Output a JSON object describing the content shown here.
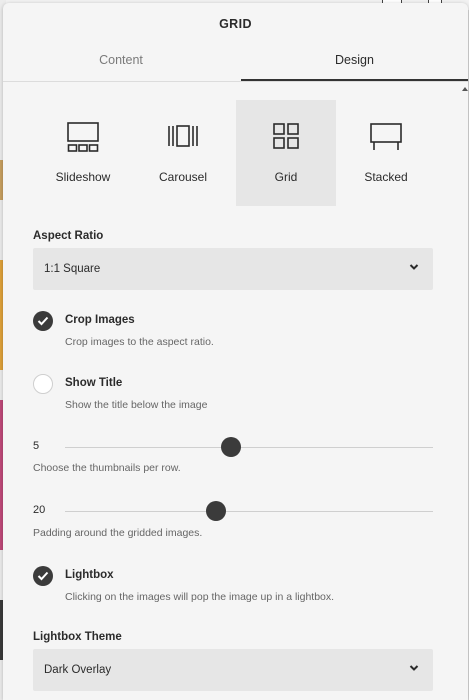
{
  "panel": {
    "title": "GRID"
  },
  "tabs": [
    {
      "label": "Content"
    },
    {
      "label": "Design"
    }
  ],
  "layouts": [
    {
      "label": "Slideshow",
      "icon": "slideshow-icon",
      "selected": false
    },
    {
      "label": "Carousel",
      "icon": "carousel-icon",
      "selected": false
    },
    {
      "label": "Grid",
      "icon": "grid-icon",
      "selected": true
    },
    {
      "label": "Stacked",
      "icon": "stacked-icon",
      "selected": false
    }
  ],
  "aspect_ratio": {
    "label": "Aspect Ratio",
    "value": "1:1 Square"
  },
  "crop_images": {
    "title": "Crop Images",
    "description": "Crop images to the aspect ratio.",
    "checked": true
  },
  "show_title": {
    "title": "Show Title",
    "description": "Show the title below the image",
    "checked": false
  },
  "thumbnails_slider": {
    "value": "5",
    "description": "Choose the thumbnails per row.",
    "level": 0.45
  },
  "padding_slider": {
    "value": "20",
    "description": "Padding around the gridded images.",
    "level": 0.41
  },
  "lightbox": {
    "title": "Lightbox",
    "description": "Clicking on the images will pop the image up in a lightbox.",
    "checked": true
  },
  "lightbox_theme": {
    "label": "Lightbox Theme",
    "value": "Dark Overlay"
  },
  "colors": {
    "accent": "#3b3b3b",
    "panel_bg": "#f5f5f5",
    "select_bg": "#e6e6e6"
  }
}
